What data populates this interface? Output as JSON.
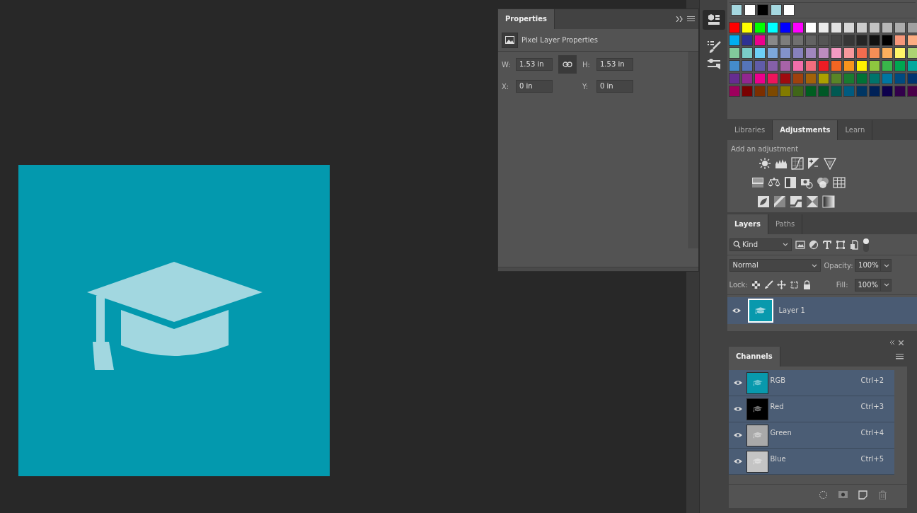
{
  "properties": {
    "title": "Properties",
    "subtitle": "Pixel Layer Properties",
    "linked": true,
    "fields": [
      {
        "label": "W:",
        "value": "1.53 in"
      },
      {
        "label": "H:",
        "value": "1.53 in"
      },
      {
        "label": "X:",
        "value": "0 in"
      },
      {
        "label": "Y:",
        "value": "0 in"
      }
    ]
  },
  "swatches": {
    "recent": [
      {
        "color": "#a5d8e0"
      },
      {
        "color": "#ffffff"
      },
      {
        "color": "#000000"
      },
      {
        "color": "#a5d8e0"
      },
      {
        "color": "#ffffff"
      }
    ],
    "grid": [
      {
        "color": "#ff0000"
      },
      {
        "color": "#ffff00"
      },
      {
        "color": "#00ff00"
      },
      {
        "color": "#00ffff"
      },
      {
        "color": "#0000ff"
      },
      {
        "color": "#ff00ff"
      },
      {
        "color": "#ffffff"
      },
      {
        "color": "#ebebeb"
      },
      {
        "color": "#e1e1e1"
      },
      {
        "color": "#d7d7d7"
      },
      {
        "color": "#cccccc"
      },
      {
        "color": "#c2c2c2"
      },
      {
        "color": "#b7b7b7"
      },
      {
        "color": "#acacac"
      },
      {
        "color": "#a0a0a0"
      },
      {
        "color": "#00aeef"
      },
      {
        "color": "#2e3192"
      },
      {
        "color": "#ec008c"
      },
      {
        "color": "#898989"
      },
      {
        "color": "#7d7d7d"
      },
      {
        "color": "#707070"
      },
      {
        "color": "#636363"
      },
      {
        "color": "#555555"
      },
      {
        "color": "#464646"
      },
      {
        "color": "#363636"
      },
      {
        "color": "#252525"
      },
      {
        "color": "#111111"
      },
      {
        "color": "#000000"
      },
      {
        "color": "#f7977a"
      },
      {
        "color": "#fbad82"
      },
      {
        "color": "#82ca9c"
      },
      {
        "color": "#7accc8"
      },
      {
        "color": "#6dcff6"
      },
      {
        "color": "#7da7d9"
      },
      {
        "color": "#8393ca"
      },
      {
        "color": "#8781bd"
      },
      {
        "color": "#a187be"
      },
      {
        "color": "#bc8cbf"
      },
      {
        "color": "#f49ac2"
      },
      {
        "color": "#f6989d"
      },
      {
        "color": "#f26c4f"
      },
      {
        "color": "#f68e56"
      },
      {
        "color": "#fbaf5d"
      },
      {
        "color": "#fff568"
      },
      {
        "color": "#acd373"
      },
      {
        "color": "#448ccb"
      },
      {
        "color": "#5574b9"
      },
      {
        "color": "#605ca8"
      },
      {
        "color": "#8560a8"
      },
      {
        "color": "#a763a8"
      },
      {
        "color": "#f06eaa"
      },
      {
        "color": "#f26d7d"
      },
      {
        "color": "#ed1c24"
      },
      {
        "color": "#f26522"
      },
      {
        "color": "#f7941d"
      },
      {
        "color": "#fff200"
      },
      {
        "color": "#8dc63f"
      },
      {
        "color": "#39b54a"
      },
      {
        "color": "#00a651"
      },
      {
        "color": "#00a99d"
      },
      {
        "color": "#662d91"
      },
      {
        "color": "#92278f"
      },
      {
        "color": "#ec008c"
      },
      {
        "color": "#ed145b"
      },
      {
        "color": "#9e0b0f"
      },
      {
        "color": "#a0410d"
      },
      {
        "color": "#a36209"
      },
      {
        "color": "#aba000"
      },
      {
        "color": "#598527"
      },
      {
        "color": "#197b30"
      },
      {
        "color": "#007236"
      },
      {
        "color": "#00746b"
      },
      {
        "color": "#0076a3"
      },
      {
        "color": "#004a80"
      },
      {
        "color": "#003471"
      },
      {
        "color": "#9e005d"
      },
      {
        "color": "#790000"
      },
      {
        "color": "#7b2e00"
      },
      {
        "color": "#7d4900"
      },
      {
        "color": "#827b00"
      },
      {
        "color": "#406618"
      },
      {
        "color": "#005e20"
      },
      {
        "color": "#005826"
      },
      {
        "color": "#005952"
      },
      {
        "color": "#005b7f"
      },
      {
        "color": "#003663"
      },
      {
        "color": "#002157"
      },
      {
        "color": "#0d004c"
      },
      {
        "color": "#32004b"
      },
      {
        "color": "#4b0049"
      }
    ]
  },
  "adjustments": {
    "tabs": [
      {
        "label": "Libraries",
        "selected": false
      },
      {
        "label": "Adjustments",
        "selected": true
      },
      {
        "label": "Learn",
        "selected": false
      }
    ],
    "hint": "Add an adjustment"
  },
  "layers": {
    "tabs": [
      {
        "label": "Layers",
        "selected": true
      },
      {
        "label": "Paths",
        "selected": false
      }
    ],
    "filter": "Kind",
    "blend_mode": "Normal",
    "opacity_label": "Opacity:",
    "opacity": "100%",
    "lock_label": "Lock:",
    "fill_label": "Fill:",
    "fill": "100%",
    "items": [
      {
        "name": "Layer 1",
        "visible": true,
        "selected": true
      }
    ]
  },
  "channels": {
    "tabs": [
      {
        "label": "Channels",
        "selected": true
      }
    ],
    "items": [
      {
        "name": "RGB",
        "shortcut": "Ctrl+2",
        "color": "#0899ad",
        "visible": true,
        "selected": true
      },
      {
        "name": "Red",
        "shortcut": "Ctrl+3",
        "color": "#000000",
        "visible": true,
        "selected": true
      },
      {
        "name": "Green",
        "shortcut": "Ctrl+4",
        "color": "#a9a9a9",
        "visible": true,
        "selected": true
      },
      {
        "name": "Blue",
        "shortcut": "Ctrl+5",
        "color": "#c4c4c4",
        "visible": true,
        "selected": true
      }
    ]
  }
}
